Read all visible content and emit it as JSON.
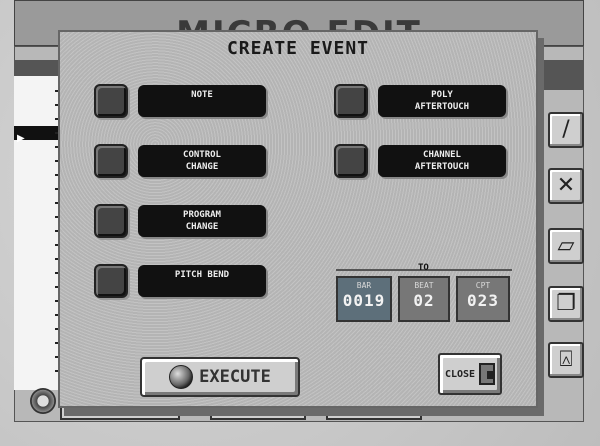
{
  "background": {
    "title": "MICRO EDIT",
    "list_marker": "▶",
    "side_buttons": [
      {
        "icon": "pencil-icon",
        "glyph": "/"
      },
      {
        "icon": "delete-x-icon",
        "glyph": "✕"
      },
      {
        "icon": "eraser-icon",
        "glyph": "▱"
      },
      {
        "icon": "copy-icon",
        "glyph": "❐"
      },
      {
        "icon": "insert-icon",
        "glyph": "⍓"
      }
    ]
  },
  "dialog": {
    "title": "CREATE EVENT",
    "options": [
      {
        "label_line1": "NOTE",
        "label_line2": ""
      },
      {
        "label_line1": "CONTROL",
        "label_line2": "CHANGE"
      },
      {
        "label_line1": "PROGRAM",
        "label_line2": "CHANGE"
      },
      {
        "label_line1": "PITCH BEND",
        "label_line2": ""
      },
      {
        "label_line1": "POLY",
        "label_line2": "AFTERTOUCH"
      },
      {
        "label_line1": "CHANNEL",
        "label_line2": "AFTERTOUCH"
      }
    ],
    "to": {
      "label": "TO",
      "bar_caption": "BAR",
      "bar_value": "0019",
      "beat_caption": "BEAT",
      "beat_value": "02",
      "clock_caption": "CPT",
      "clock_value": "023"
    },
    "execute_label": "EXECUTE",
    "close_label": "CLOSE"
  }
}
